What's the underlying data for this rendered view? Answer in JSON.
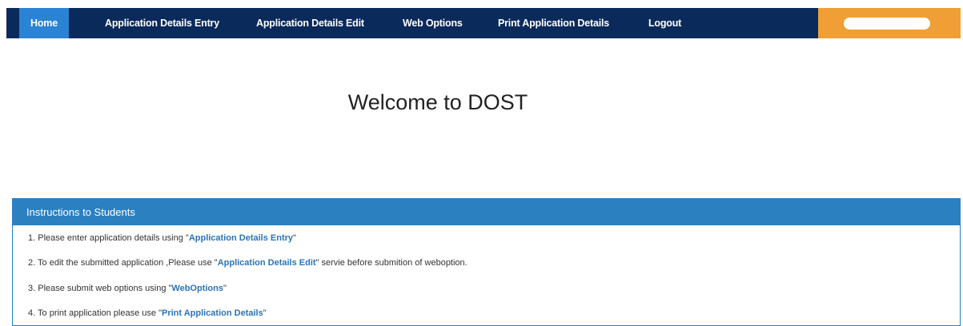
{
  "nav": {
    "items": [
      {
        "label": "Home",
        "active": true
      },
      {
        "label": "Application Details Entry",
        "active": false
      },
      {
        "label": "Application Details Edit",
        "active": false
      },
      {
        "label": "Web Options",
        "active": false
      },
      {
        "label": "Print Application Details",
        "active": false
      },
      {
        "label": "Logout",
        "active": false
      }
    ]
  },
  "colors": {
    "nav_bg": "#0b2a5c",
    "nav_active": "#2a83d4",
    "nav_user_area": "#ef9f35",
    "panel_header": "#2b80c0",
    "link": "#2a74b8"
  },
  "welcome": {
    "title": "Welcome to DOST"
  },
  "instructions": {
    "header": "Instructions to Students",
    "items": [
      {
        "prefix": "1. Please enter application details using \"",
        "link": "Application Details Entry",
        "suffix": "\""
      },
      {
        "prefix": "2. To edit the submitted application ,Please use \"",
        "link": "Application Details Edit",
        "suffix": "\" servie before submition of weboption."
      },
      {
        "prefix": "3. Please submit web options using \"",
        "link": "WebOptions",
        "suffix": "\""
      },
      {
        "prefix": "4. To print application please use \"",
        "link": "Print Application Details",
        "suffix": "\""
      }
    ]
  }
}
